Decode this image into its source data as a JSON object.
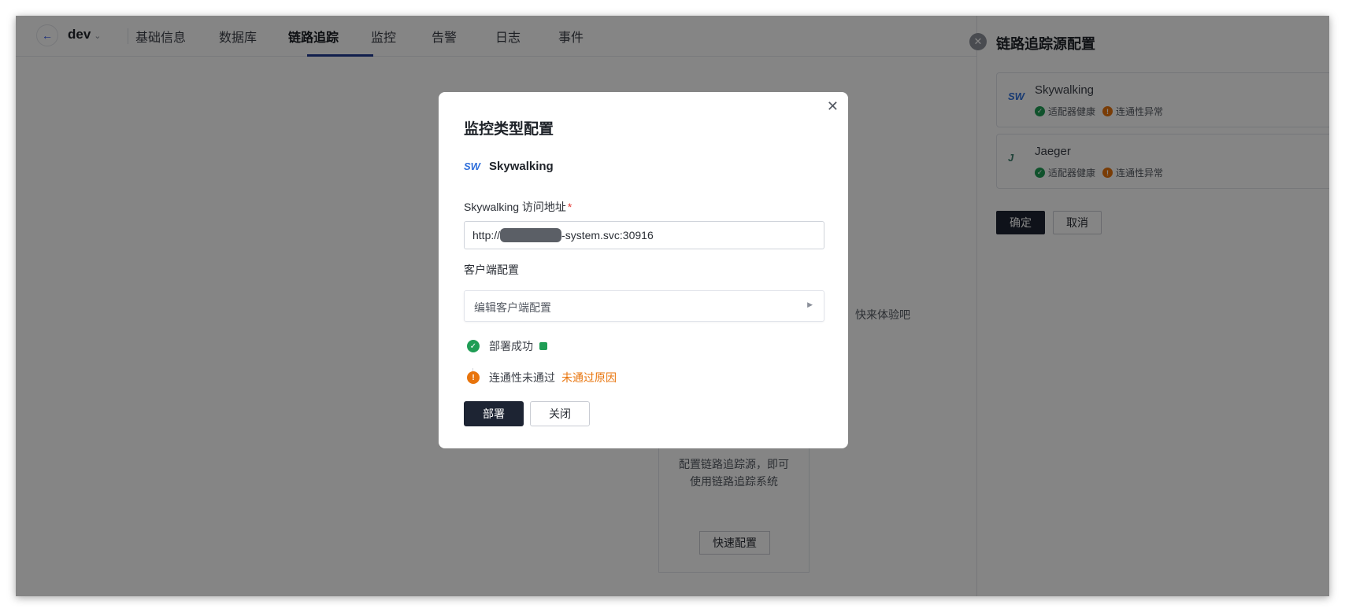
{
  "header": {
    "back_icon": "arrow-left-icon",
    "env": "dev",
    "env_chevron": "⌄",
    "tabs": [
      {
        "label": "基础信息"
      },
      {
        "label": "数据库"
      },
      {
        "label": "链路追踪",
        "active": true
      },
      {
        "label": "监控"
      },
      {
        "label": "告警"
      },
      {
        "label": "日志"
      },
      {
        "label": "事件"
      }
    ]
  },
  "background": {
    "hint": "快来体验吧",
    "card_line1": "配置链路追踪源，即可",
    "card_line2": "使用链路追踪系统",
    "quick_config": "快速配置"
  },
  "drawer": {
    "title": "链路追踪源配置",
    "close_icon": "close-circle-icon",
    "sources": [
      {
        "logo": "SW",
        "name": "Skywalking",
        "adapter": "适配器健康",
        "connectivity": "连通性异常"
      },
      {
        "logo": "J",
        "name": "Jaeger",
        "adapter": "适配器健康",
        "connectivity": "连通性异常"
      }
    ],
    "confirm": "确定",
    "cancel": "取消"
  },
  "modal": {
    "title": "监控类型配置",
    "provider_logo": "SW",
    "provider_name": "Skywalking",
    "url_label": "Skywalking 访问地址",
    "url_required": "*",
    "url_prefix": "http://",
    "url_suffix": "-system.svc:30916",
    "client_label": "客户端配置",
    "client_row": "编辑客户端配置",
    "steps": [
      {
        "label": "部署成功",
        "status": "success"
      },
      {
        "label": "连通性未通过",
        "status": "warning",
        "link": "未通过原因"
      }
    ],
    "deploy": "部署",
    "close": "关闭"
  },
  "colors": {
    "primary": "#1d2433",
    "success": "#1f9d55",
    "warning": "#e8740c",
    "required": "#e53935"
  }
}
